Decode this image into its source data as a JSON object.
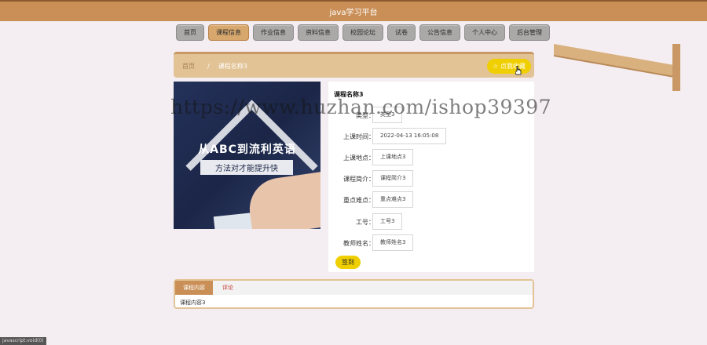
{
  "header": {
    "title": "java学习平台"
  },
  "nav": {
    "items": [
      {
        "label": "首页"
      },
      {
        "label": "课程信息"
      },
      {
        "label": "作业信息"
      },
      {
        "label": "资料信息"
      },
      {
        "label": "校园论坛"
      },
      {
        "label": "试卷"
      },
      {
        "label": "公告信息"
      },
      {
        "label": "个人中心"
      },
      {
        "label": "后台管理"
      }
    ]
  },
  "breadcrumb": {
    "home": "首页",
    "separator": "/",
    "current": "课程名称3"
  },
  "favorite_button": {
    "label": "☆ 点我收藏"
  },
  "course_image": {
    "line1": "从ABC到流利英语",
    "line2": "方法对才能提升快"
  },
  "detail": {
    "title": "课程名称3",
    "fields": [
      {
        "label": "类型：",
        "value": "类型3"
      },
      {
        "label": "上课时间：",
        "value": "2022-04-13 16:05:08"
      },
      {
        "label": "上课地点：",
        "value": "上课地点3"
      },
      {
        "label": "课程简介：",
        "value": "课程简介3"
      },
      {
        "label": "重点难点：",
        "value": "重点难点3"
      },
      {
        "label": "工号：",
        "value": "工号3"
      },
      {
        "label": "教师姓名：",
        "value": "教师姓名3"
      }
    ],
    "sign_button": "签到"
  },
  "tabs": {
    "items": [
      {
        "label": "课程内容"
      },
      {
        "label": "评论"
      }
    ],
    "content": "课程内容3"
  },
  "watermark": "https://www.huzhan.com/ishop39397",
  "status_bar": "javascript:void(0)",
  "colors": {
    "header": "#c98f57",
    "accent_yellow": "#f0cf00",
    "breadcrumb_bg": "#e2c395"
  }
}
